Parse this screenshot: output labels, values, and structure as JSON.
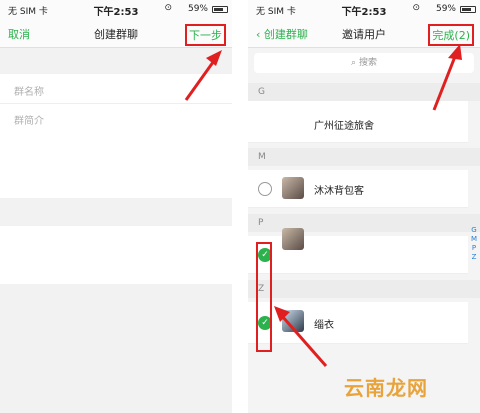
{
  "left": {
    "status": {
      "carrier": "无 SIM 卡",
      "time": "下午2:53",
      "battery": "59%"
    },
    "nav": {
      "left": "取消",
      "title": "创建群聊",
      "right": "下一步"
    },
    "fields": {
      "group_name_placeholder": "群名称",
      "group_intro_placeholder": "群简介"
    }
  },
  "right": {
    "status": {
      "carrier": "无 SIM 卡",
      "time": "下午2:53",
      "battery": "59%"
    },
    "nav": {
      "back": "创建群聊",
      "title": "邀请用户",
      "done": "完成(2)"
    },
    "search": {
      "placeholder": "搜索"
    },
    "sections": [
      {
        "header": "G",
        "contacts": [
          {
            "name": "广州征途旅舍",
            "selected": false
          }
        ]
      },
      {
        "header": "M",
        "contacts": [
          {
            "name": "沐沐背包客",
            "selected": false
          }
        ]
      },
      {
        "header": "P",
        "contacts": [
          {
            "name": "",
            "selected": true
          }
        ]
      },
      {
        "header": "Z",
        "contacts": [
          {
            "name": "缁衣",
            "selected": true
          }
        ]
      }
    ],
    "index": [
      "G",
      "M",
      "P",
      "Z"
    ]
  },
  "watermark": "云南龙网"
}
